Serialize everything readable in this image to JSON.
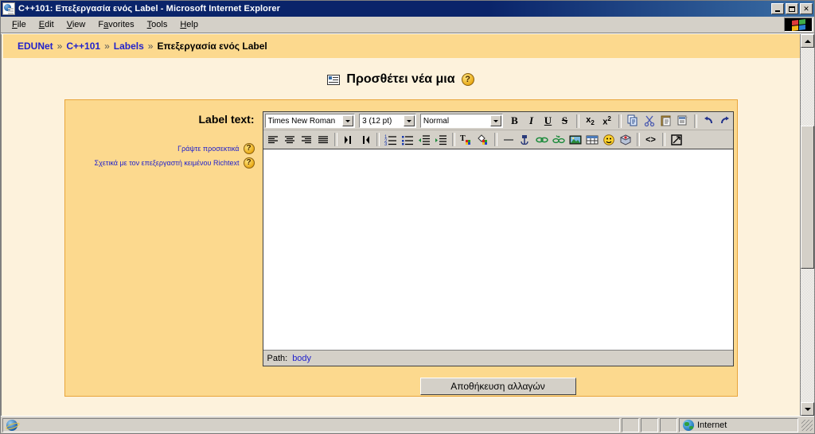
{
  "window": {
    "title": "C++101: Επεξεργασία ενός Label - Microsoft Internet Explorer",
    "icon": "ie-document-icon",
    "minimize_label": "Minimize",
    "maximize_label": "Maximize",
    "close_label": "✕"
  },
  "menu": {
    "items": [
      {
        "label": "File",
        "accel": "F",
        "rest": "ile"
      },
      {
        "label": "Edit",
        "accel": "E",
        "rest": "dit"
      },
      {
        "label": "View",
        "accel": "V",
        "rest": "iew"
      },
      {
        "label": "Favorites",
        "pre": "F",
        "accel": "a",
        "rest": "vorites"
      },
      {
        "label": "Tools",
        "accel": "T",
        "rest": "ools"
      },
      {
        "label": "Help",
        "accel": "H",
        "rest": "elp"
      }
    ]
  },
  "breadcrumb": {
    "items": [
      "EDUNet",
      "C++101",
      "Labels"
    ],
    "current": "Επεξεργασία ενός Label",
    "separator": "»"
  },
  "heading": {
    "text": "Προσθέτει νέα μια",
    "help_glyph": "?",
    "icon": "label-icon"
  },
  "form": {
    "field_label": "Label text:",
    "hints": [
      {
        "text": "Γράψτε προσεκτικά",
        "help_glyph": "?"
      },
      {
        "text": "Σχετικά με τον επεξεργαστή κειμένου Richtext",
        "help_glyph": "?"
      }
    ],
    "save_label": "Αποθήκευση αλλαγών"
  },
  "editor": {
    "font_family": "Times New Roman",
    "font_size": "3 (12 pt)",
    "paragraph_style": "Normal",
    "content": "",
    "path_label": "Path:",
    "path_value": "body",
    "toolbar_row1": [
      {
        "name": "bold-button",
        "glyph": "B"
      },
      {
        "name": "italic-button",
        "glyph": "I"
      },
      {
        "name": "underline-button",
        "glyph": "U"
      },
      {
        "name": "strikethrough-button",
        "glyph": "S"
      },
      {
        "name": "subscript-button",
        "glyph": "x₂"
      },
      {
        "name": "superscript-button",
        "glyph": "x²"
      },
      {
        "name": "copy-button",
        "glyph": "copy"
      },
      {
        "name": "cut-button",
        "glyph": "cut"
      },
      {
        "name": "paste-button",
        "glyph": "paste"
      },
      {
        "name": "paste-from-word-button",
        "glyph": "paste-word"
      },
      {
        "name": "undo-button",
        "glyph": "↰"
      },
      {
        "name": "redo-button",
        "glyph": "↱"
      }
    ],
    "toolbar_row2": [
      {
        "name": "align-left-button",
        "glyph": "align-left"
      },
      {
        "name": "align-center-button",
        "glyph": "align-center"
      },
      {
        "name": "align-right-button",
        "glyph": "align-right"
      },
      {
        "name": "align-justify-button",
        "glyph": "align-justify"
      },
      {
        "name": "direction-ltr-button",
        "glyph": "ltr"
      },
      {
        "name": "direction-rtl-button",
        "glyph": "rtl"
      },
      {
        "name": "ordered-list-button",
        "glyph": "ol"
      },
      {
        "name": "unordered-list-button",
        "glyph": "ul"
      },
      {
        "name": "outdent-button",
        "glyph": "outdent"
      },
      {
        "name": "indent-button",
        "glyph": "indent"
      },
      {
        "name": "text-color-button",
        "glyph": "text-color"
      },
      {
        "name": "background-color-button",
        "glyph": "bg-color"
      },
      {
        "name": "horizontal-rule-button",
        "glyph": "hr"
      },
      {
        "name": "anchor-button",
        "glyph": "anchor"
      },
      {
        "name": "insert-link-button",
        "glyph": "link"
      },
      {
        "name": "unlink-button",
        "glyph": "unlink"
      },
      {
        "name": "insert-image-button",
        "glyph": "image"
      },
      {
        "name": "insert-table-button",
        "glyph": "table"
      },
      {
        "name": "insert-emoticon-button",
        "glyph": "emoticon"
      },
      {
        "name": "insert-media-button",
        "glyph": "media"
      },
      {
        "name": "html-source-button",
        "glyph": "<>"
      },
      {
        "name": "fullscreen-button",
        "glyph": "fullscreen"
      }
    ]
  },
  "statusbar": {
    "message": "",
    "zone": "Internet",
    "zone_icon": "globe-icon"
  },
  "colors": {
    "page_background": "#fdf2dc",
    "form_background": "#fcd98e",
    "form_border": "#e8a53a",
    "link": "#2222cc",
    "titlebar": "#0a246a",
    "chrome": "#d4d0c8"
  }
}
